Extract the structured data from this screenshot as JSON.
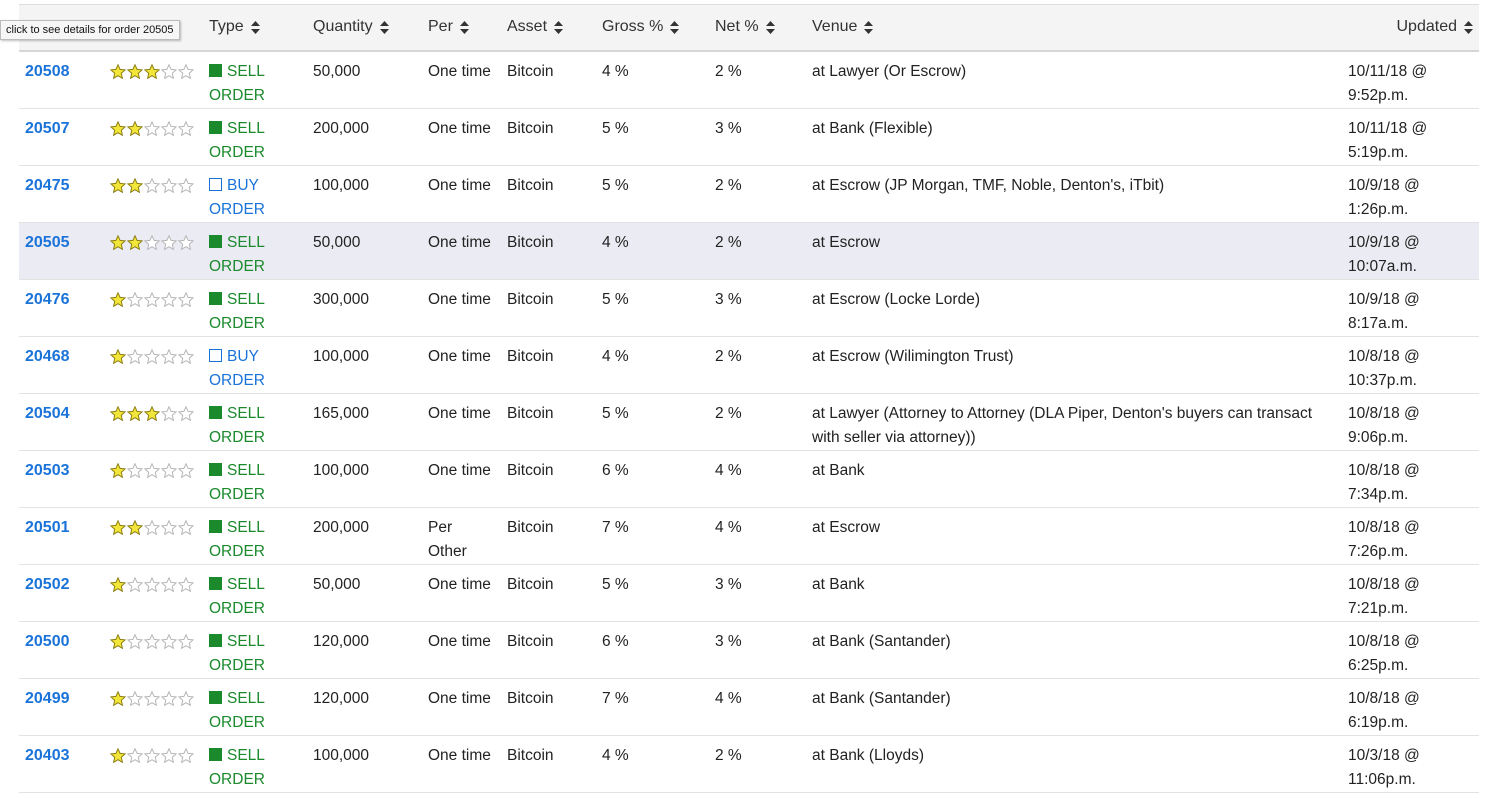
{
  "tooltip": "click to see details for order 20505",
  "columns": [
    "",
    "",
    "Type",
    "Quantity",
    "Per",
    "Asset",
    "Gross %",
    "Net %",
    "Venue",
    "Updated"
  ],
  "colors": {
    "link": "#1a73d9",
    "sell": "#1b8a2d",
    "star": "#f2e63a",
    "highlight_row": "#ebebf3"
  },
  "orders": [
    {
      "id": "20508",
      "rating": 3,
      "type": "sell",
      "type_line1": "SELL",
      "type_line2": "ORDER",
      "quantity": "50,000",
      "per": "One time",
      "asset": "Bitcoin",
      "gross": "4 %",
      "net": "2 %",
      "venue": "at Lawyer (Or Escrow)",
      "updated_line1": "10/11/18 @",
      "updated_line2": "9:52p.m."
    },
    {
      "id": "20507",
      "rating": 2,
      "type": "sell",
      "type_line1": "SELL",
      "type_line2": "ORDER",
      "quantity": "200,000",
      "per": "One time",
      "asset": "Bitcoin",
      "gross": "5 %",
      "net": "3 %",
      "venue": "at Bank (Flexible)",
      "updated_line1": "10/11/18 @",
      "updated_line2": "5:19p.m."
    },
    {
      "id": "20475",
      "rating": 2,
      "type": "buy",
      "type_line1": "BUY",
      "type_line2": "ORDER",
      "quantity": "100,000",
      "per": "One time",
      "asset": "Bitcoin",
      "gross": "5 %",
      "net": "2 %",
      "venue": "at Escrow (JP Morgan, TMF, Noble, Denton's, iTbit)",
      "updated_line1": "10/9/18 @",
      "updated_line2": "1:26p.m."
    },
    {
      "id": "20505",
      "rating": 2,
      "type": "sell",
      "type_line1": "SELL",
      "type_line2": "ORDER",
      "quantity": "50,000",
      "per": "One time",
      "asset": "Bitcoin",
      "gross": "4 %",
      "net": "2 %",
      "venue": "at Escrow",
      "updated_line1": "10/9/18 @",
      "updated_line2": "10:07a.m.",
      "highlighted": true
    },
    {
      "id": "20476",
      "rating": 1,
      "type": "sell",
      "type_line1": "SELL",
      "type_line2": "ORDER",
      "quantity": "300,000",
      "per": "One time",
      "asset": "Bitcoin",
      "gross": "5 %",
      "net": "3 %",
      "venue": "at Escrow (Locke Lorde)",
      "updated_line1": "10/9/18 @",
      "updated_line2": "8:17a.m."
    },
    {
      "id": "20468",
      "rating": 1,
      "type": "buy",
      "type_line1": "BUY",
      "type_line2": "ORDER",
      "quantity": "100,000",
      "per": "One time",
      "asset": "Bitcoin",
      "gross": "4 %",
      "net": "2 %",
      "venue": "at Escrow (Wilimington Trust)",
      "updated_line1": "10/8/18 @",
      "updated_line2": "10:37p.m."
    },
    {
      "id": "20504",
      "rating": 3,
      "type": "sell",
      "type_line1": "SELL",
      "type_line2": "ORDER",
      "quantity": "165,000",
      "per": "One time",
      "asset": "Bitcoin",
      "gross": "5 %",
      "net": "2 %",
      "venue": "at Lawyer (Attorney to Attorney (DLA Piper, Denton's buyers can transact with seller via attorney))",
      "updated_line1": "10/8/18 @",
      "updated_line2": "9:06p.m."
    },
    {
      "id": "20503",
      "rating": 1,
      "type": "sell",
      "type_line1": "SELL",
      "type_line2": "ORDER",
      "quantity": "100,000",
      "per": "One time",
      "asset": "Bitcoin",
      "gross": "6 %",
      "net": "4 %",
      "venue": "at Bank",
      "updated_line1": "10/8/18 @",
      "updated_line2": "7:34p.m."
    },
    {
      "id": "20501",
      "rating": 2,
      "type": "sell",
      "type_line1": "SELL",
      "type_line2": "ORDER",
      "quantity": "200,000",
      "per": "Per Other",
      "asset": "Bitcoin",
      "gross": "7 %",
      "net": "4 %",
      "venue": "at Escrow",
      "updated_line1": "10/8/18 @",
      "updated_line2": "7:26p.m."
    },
    {
      "id": "20502",
      "rating": 1,
      "type": "sell",
      "type_line1": "SELL",
      "type_line2": "ORDER",
      "quantity": "50,000",
      "per": "One time",
      "asset": "Bitcoin",
      "gross": "5 %",
      "net": "3 %",
      "venue": "at Bank",
      "updated_line1": "10/8/18 @",
      "updated_line2": "7:21p.m."
    },
    {
      "id": "20500",
      "rating": 1,
      "type": "sell",
      "type_line1": "SELL",
      "type_line2": "ORDER",
      "quantity": "120,000",
      "per": "One time",
      "asset": "Bitcoin",
      "gross": "6 %",
      "net": "3 %",
      "venue": "at Bank (Santander)",
      "updated_line1": "10/8/18 @",
      "updated_line2": "6:25p.m."
    },
    {
      "id": "20499",
      "rating": 1,
      "type": "sell",
      "type_line1": "SELL",
      "type_line2": "ORDER",
      "quantity": "120,000",
      "per": "One time",
      "asset": "Bitcoin",
      "gross": "7 %",
      "net": "4 %",
      "venue": "at Bank (Santander)",
      "updated_line1": "10/8/18 @",
      "updated_line2": "6:19p.m."
    },
    {
      "id": "20403",
      "rating": 1,
      "type": "sell",
      "type_line1": "SELL",
      "type_line2": "ORDER",
      "quantity": "100,000",
      "per": "One time",
      "asset": "Bitcoin",
      "gross": "4 %",
      "net": "2 %",
      "venue": "at Bank (Lloyds)",
      "updated_line1": "10/3/18 @",
      "updated_line2": "11:06p.m."
    }
  ]
}
